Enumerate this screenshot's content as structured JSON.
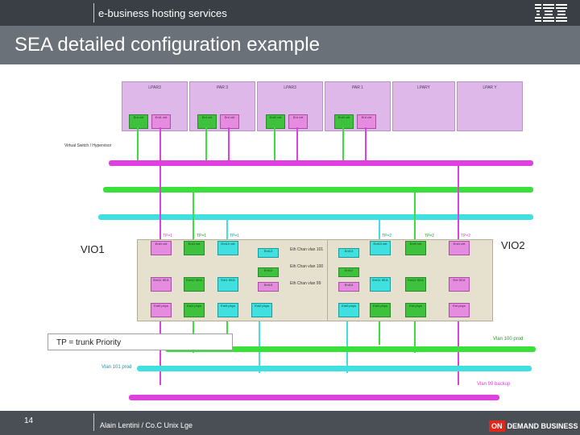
{
  "header": {
    "title": "e-business hosting services",
    "logo": "IBM"
  },
  "slide": {
    "title": "SEA detailed configuration example"
  },
  "footer": {
    "page_number": "14",
    "author": "Alain Lentini / Co.C Unix Lge",
    "brand_on": "ON",
    "brand_text": "DEMAND BUSINESS"
  },
  "diagram": {
    "lpars": [
      "LPAR3",
      "PAR 3",
      "LPAR3",
      "PAR 1",
      "LPARY",
      "LPAR Y"
    ],
    "hypervisor_label": "Virtual Switch / Hypervisor",
    "vio1": "VIO1",
    "vio2": "VIO2",
    "tp_note": "TP = trunk Priority",
    "vlan_100": "Vlan 100 prod",
    "vlan_101": "Vlan 101 prod",
    "vlan_99": "Vlan 99 backup",
    "tp_labels": [
      "TP=1",
      "TP=1",
      "TP=1",
      "TP=2",
      "TP=2",
      "TP=2"
    ],
    "ether_channels": [
      "Eth Chan vlan 101",
      "Eth Chan vlan 100",
      "Eth Chan vlan 99"
    ],
    "vio1_adapters": [
      "Ent4 virt",
      "Ent3 virt",
      "Ent10 virt",
      "Ent13",
      "Ent11 SEA",
      "Ent12 SEA",
      "Ent1 SEA",
      "Ent0 phys",
      "Ent1 phys",
      "Ent9 phys",
      "Ent12",
      "Ent2 phys",
      "Ent13"
    ],
    "vio2_adapters": [
      "Ent13",
      "Ent10 virt",
      "Ent9 virt",
      "Ent4 virt",
      "Ent12",
      "Ent11 SEA",
      "Ent12 SEA",
      "Ent SEA",
      "Ent13",
      "Ent0 phys",
      "Ent1 phys",
      "Ent phys",
      "Ent phys"
    ],
    "lpar_adapters": [
      "Ent virt",
      "Ent1 virt",
      "Ent virt",
      "Ent virt",
      "Ent0 virt",
      "Ent virt",
      "Ent0 virt",
      "Ent virt"
    ],
    "colors": {
      "green_bus": "#39e039",
      "magenta_bus": "#e040e0",
      "cyan_bus": "#40e0e0",
      "lpar_fill": "#ddb8e8",
      "vio_fill": "#e6e1cf"
    }
  }
}
